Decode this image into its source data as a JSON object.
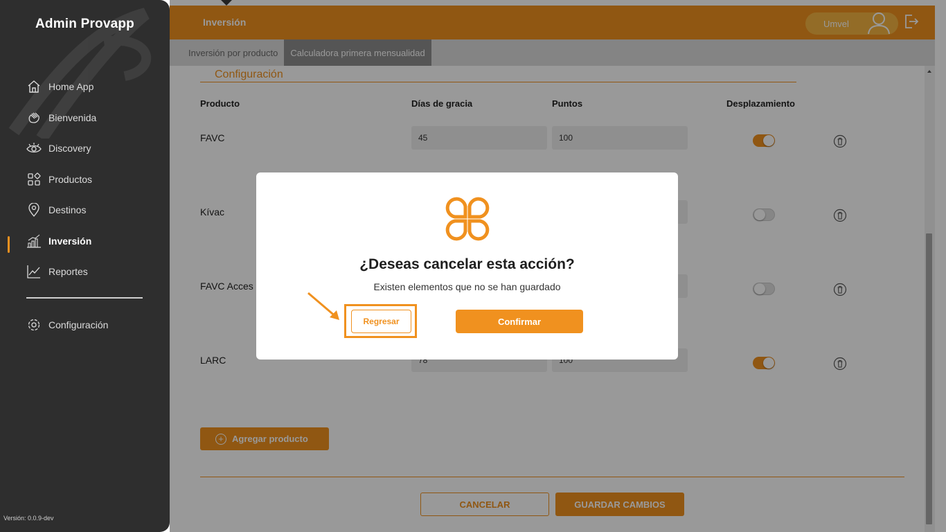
{
  "app": {
    "brand": "Admin Provapp",
    "version": "Versión: 0.0.9-dev"
  },
  "sidebar": {
    "items": [
      {
        "label": "Home App",
        "icon": "home-icon"
      },
      {
        "label": "Bienvenida",
        "icon": "waving-hand-icon"
      },
      {
        "label": "Discovery",
        "icon": "eye-icon"
      },
      {
        "label": "Productos",
        "icon": "grid-icon"
      },
      {
        "label": "Destinos",
        "icon": "map-pin-icon"
      },
      {
        "label": "Inversión",
        "icon": "bar-chart-icon",
        "active": true
      },
      {
        "label": "Reportes",
        "icon": "line-chart-icon"
      }
    ],
    "settings": {
      "label": "Configuración",
      "icon": "gear-icon"
    }
  },
  "header": {
    "title": "Inversión",
    "user_name": "Umvel"
  },
  "tabs": [
    {
      "label": "Inversión por producto",
      "active": false
    },
    {
      "label": "Calculadora primera mensualidad",
      "active": true
    }
  ],
  "config": {
    "section_title": "Configuración",
    "columns": [
      "Producto",
      "Días de gracia",
      "Puntos",
      "Desplazamiento"
    ],
    "rows": [
      {
        "product": "FAVC",
        "grace_days": "45",
        "points": "100",
        "displacement": true
      },
      {
        "product": "Kívac",
        "grace_days": "",
        "points": "",
        "displacement": false
      },
      {
        "product": "FAVC Acces",
        "grace_days": "",
        "points": "",
        "displacement": false
      },
      {
        "product": "LARC",
        "grace_days": "78",
        "points": "100",
        "displacement": true
      }
    ],
    "add_product_label": "Agregar producto",
    "cancel_label": "CANCELAR",
    "save_label": "GUARDAR CAMBIOS"
  },
  "modal": {
    "title": "¿Deseas cancelar esta acción?",
    "subtitle": "Existen elementos que no se han guardado",
    "back_label": "Regresar",
    "confirm_label": "Confirmar"
  },
  "colors": {
    "accent": "#f0911f",
    "sidebar_bg": "#2e2e2e",
    "tab_active_bg": "#8e8e8e",
    "overlay": "rgba(0,0,0,0.4)"
  }
}
